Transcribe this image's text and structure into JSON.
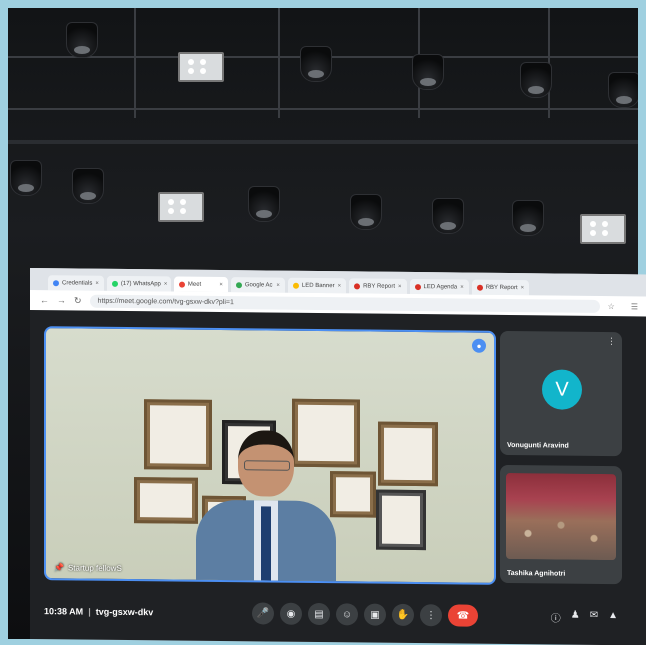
{
  "browser": {
    "tabs": [
      {
        "label": "Credentials",
        "active": false,
        "color": "#4285f4"
      },
      {
        "label": "(17) WhatsApp",
        "active": false,
        "color": "#25d366"
      },
      {
        "label": "Meet",
        "active": true,
        "color": "#ea4335"
      },
      {
        "label": "Google Ac",
        "active": false,
        "color": "#34a853"
      },
      {
        "label": "LED Banner",
        "active": false,
        "color": "#fbbc04"
      },
      {
        "label": "RBY Report",
        "active": false,
        "color": "#d93025"
      },
      {
        "label": "LED Agenda",
        "active": false,
        "color": "#d93025"
      },
      {
        "label": "RBY Report",
        "active": false,
        "color": "#d93025"
      }
    ],
    "url": "https://meet.google.com/tvg-gsxw-dkv?pli=1",
    "nav_icons": [
      "back-arrow-icon",
      "forward-arrow-icon",
      "reload-icon"
    ]
  },
  "meet": {
    "main_tile": {
      "name": "Startup fellowS"
    },
    "participants": [
      {
        "name": "Vonugunti Aravind",
        "initial": "V",
        "avatar_color": "#12b5cb"
      },
      {
        "name": "Tashika Agnihotri"
      }
    ],
    "time": "10:38 AM",
    "meeting_code": "tvg-gsxw-dkv",
    "controls": [
      "mic-icon",
      "camera-icon",
      "captions-icon",
      "emoji-icon",
      "present-icon",
      "raise-hand-icon",
      "more-options-icon",
      "end-call-icon"
    ],
    "right_icons": [
      "info-icon",
      "people-icon",
      "chat-icon",
      "activities-icon"
    ]
  }
}
